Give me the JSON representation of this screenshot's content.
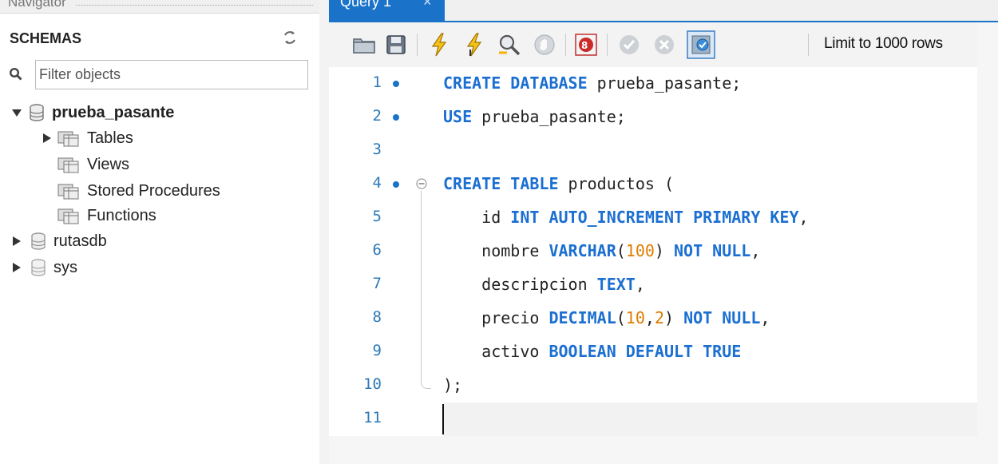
{
  "navigator": {
    "title": "Navigator",
    "schemas_label": "SCHEMAS",
    "filter_placeholder": "Filter objects",
    "tree": [
      {
        "label": "prueba_pasante",
        "expanded": true,
        "bold": true
      },
      {
        "label": "Tables",
        "expanded": false
      },
      {
        "label": "Views"
      },
      {
        "label": "Stored Procedures"
      },
      {
        "label": "Functions"
      },
      {
        "label": "rutasdb",
        "expanded": false
      },
      {
        "label": "sys",
        "expanded": false
      }
    ]
  },
  "editor": {
    "tab_label": "Query 1",
    "tab_close": "×",
    "toolbar": {
      "icons": [
        "open-folder-icon",
        "save-icon",
        "execute-icon",
        "execute-current-icon",
        "explain-icon",
        "stop-icon",
        "toggle-error-icon",
        "commit-icon",
        "rollback-icon",
        "autocommit-icon"
      ],
      "limit_label": "Limit to 1000 rows"
    },
    "lines": [
      {
        "n": "1",
        "marker": true,
        "text": [
          [
            "kw",
            "CREATE DATABASE"
          ],
          [
            "plain",
            " prueba_pasante;"
          ]
        ]
      },
      {
        "n": "2",
        "marker": true,
        "text": [
          [
            "kw",
            "USE"
          ],
          [
            "plain",
            " prueba_pasante;"
          ]
        ]
      },
      {
        "n": "3",
        "marker": false,
        "text": []
      },
      {
        "n": "4",
        "marker": true,
        "text": [
          [
            "kw",
            "CREATE TABLE"
          ],
          [
            "plain",
            " productos ("
          ]
        ]
      },
      {
        "n": "5",
        "marker": false,
        "text": [
          [
            "plain",
            "    id "
          ],
          [
            "kw",
            "INT AUTO_INCREMENT PRIMARY KEY"
          ],
          [
            "plain",
            ","
          ]
        ]
      },
      {
        "n": "6",
        "marker": false,
        "text": [
          [
            "plain",
            "    nombre "
          ],
          [
            "kw",
            "VARCHAR"
          ],
          [
            "plain",
            "("
          ],
          [
            "num",
            "100"
          ],
          [
            "plain",
            ") "
          ],
          [
            "kw",
            "NOT NULL"
          ],
          [
            "plain",
            ","
          ]
        ]
      },
      {
        "n": "7",
        "marker": false,
        "text": [
          [
            "plain",
            "    descripcion "
          ],
          [
            "kw",
            "TEXT"
          ],
          [
            "plain",
            ","
          ]
        ]
      },
      {
        "n": "8",
        "marker": false,
        "text": [
          [
            "plain",
            "    precio "
          ],
          [
            "kw",
            "DECIMAL"
          ],
          [
            "plain",
            "("
          ],
          [
            "num",
            "10"
          ],
          [
            "plain",
            ","
          ],
          [
            "num",
            "2"
          ],
          [
            "plain",
            ") "
          ],
          [
            "kw",
            "NOT NULL"
          ],
          [
            "plain",
            ","
          ]
        ]
      },
      {
        "n": "9",
        "marker": false,
        "text": [
          [
            "plain",
            "    activo "
          ],
          [
            "kw",
            "BOOLEAN DEFAULT TRUE"
          ]
        ]
      },
      {
        "n": "10",
        "marker": false,
        "text": [
          [
            "plain",
            ");"
          ]
        ]
      },
      {
        "n": "11",
        "marker": false,
        "text": []
      }
    ]
  },
  "colors": {
    "accent": "#1a73c9",
    "keyword": "#1b6fd1",
    "number": "#e07b00",
    "line_number": "#2d7ab8"
  }
}
